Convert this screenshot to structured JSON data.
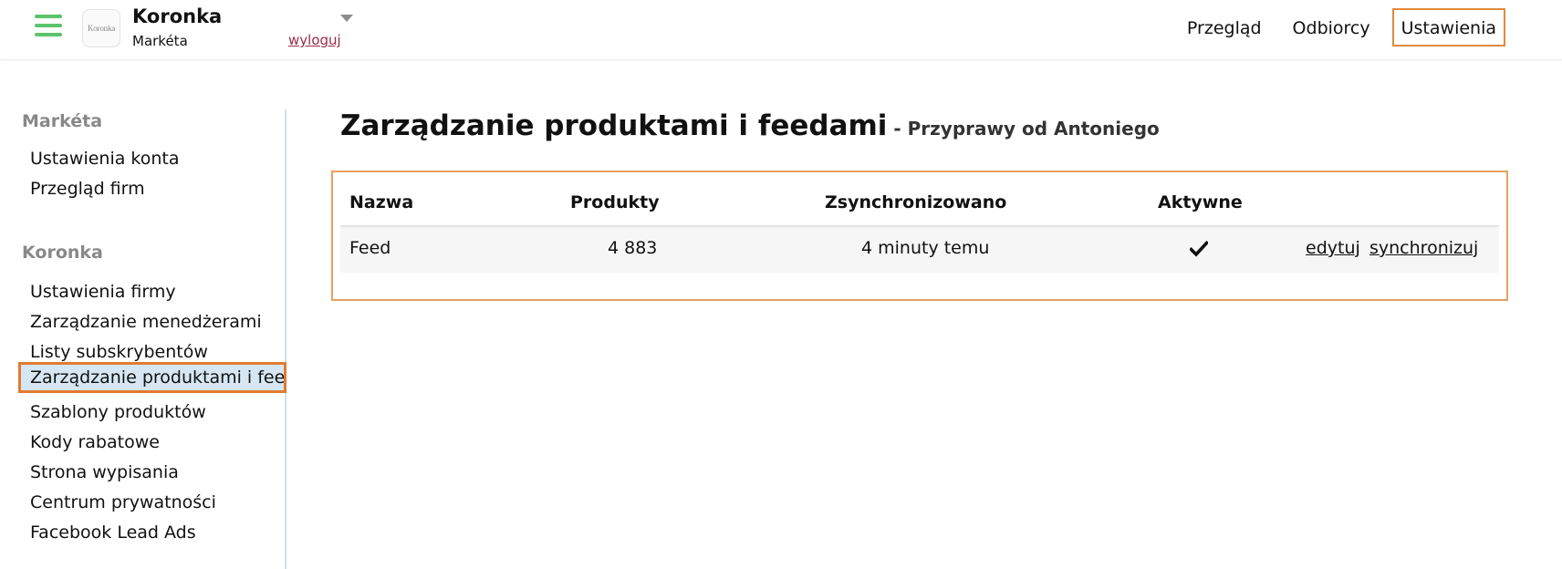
{
  "header": {
    "logo_text": "Koronka",
    "account_name": "Koronka",
    "user_name": "Markéta",
    "logout_label": "wyloguj",
    "nav": [
      {
        "label": "Przegląd",
        "active": false
      },
      {
        "label": "Odbiorcy",
        "active": false
      },
      {
        "label": "Ustawienia",
        "active": true
      }
    ]
  },
  "sidebar": {
    "sections": [
      {
        "heading": "Markéta",
        "items": [
          {
            "label": "Ustawienia konta"
          },
          {
            "label": "Przegląd firm"
          }
        ]
      },
      {
        "heading": "Koronka",
        "items": [
          {
            "label": "Ustawienia firmy"
          },
          {
            "label": "Zarządzanie menedżerami"
          },
          {
            "label": "Listy subskrybentów"
          },
          {
            "label": "Zarządzanie produktami i feedami",
            "active": true
          },
          {
            "label": "Szablony produktów"
          },
          {
            "label": "Kody rabatowe"
          },
          {
            "label": "Strona wypisania"
          },
          {
            "label": "Centrum prywatności"
          },
          {
            "label": "Facebook Lead Ads"
          }
        ]
      }
    ]
  },
  "main": {
    "title": "Zarządzanie produktami i feedami",
    "subtitle": " - Przyprawy od Antoniego",
    "table": {
      "columns": [
        "Nazwa",
        "Produkty",
        "Zsynchronizowano",
        "Aktywne"
      ],
      "rows": [
        {
          "name": "Feed",
          "products": "4 883",
          "synced": "4 minuty temu",
          "active": true,
          "actions": [
            "edytuj",
            "synchronizuj"
          ]
        }
      ]
    }
  },
  "colors": {
    "accent_orange": "#e08a3c",
    "hamburger_green": "#5cc36a",
    "logout_link": "#9b2c46",
    "active_sidebar_bg": "#d6e7f3"
  },
  "icons": {
    "menu": "hamburger-icon",
    "dropdown": "caret-down-icon",
    "active_flag": "checkmark-icon"
  }
}
